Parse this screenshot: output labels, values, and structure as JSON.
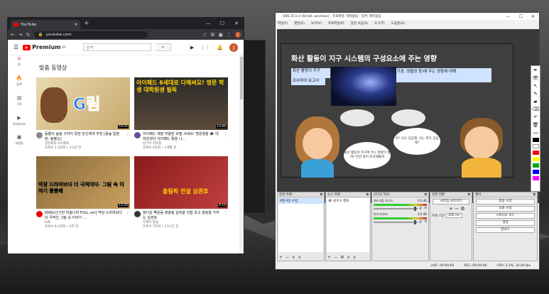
{
  "chrome": {
    "tab_title": "YouTube",
    "new_tab": "+",
    "minimize": "—",
    "maximize": "☐",
    "close": "✕",
    "url": "youtube.com",
    "profile_initial": "J"
  },
  "youtube": {
    "logo": "Premium",
    "logo_region": "KR",
    "search_placeholder": "검색",
    "avatar_initial": "J",
    "nav": [
      {
        "label": "홈",
        "icon": "⌂"
      },
      {
        "label": "탐색",
        "icon": "🔥"
      },
      {
        "label": "구독",
        "icon": "▤"
      },
      {
        "label": "Originals",
        "icon": "▶"
      },
      {
        "label": "보관함",
        "icon": "▣"
      }
    ],
    "section_title": "맞춤 동영상",
    "videos": [
      {
        "title": "동물의 숲을 구하지 못한 당신에게 추천 [동숲 일본판: 팀블드]",
        "channel": "김성회의 G식백과",
        "stats": "조회수 1.3만회 • 1시간 전",
        "duration": "10:25",
        "thumb_text": "G림"
      },
      {
        "title": "아이패드 계발 저렴한 모델 사세요! 명문영을 🎓 대학원생의 아이패드 활용 나...",
        "channel": "방구석 리뷰룸",
        "stats": "조회수 4만회 • 1개월 전",
        "duration": "13:06",
        "thumb_text": "아이패드 6세대로 다해써요! 명문 학생 대학원생 필독"
      },
      {
        "title": "[ENG/신기한 미술나라 FULL ver] 딱당 드라마보다 더 극적인 그림 속 이야기 ...",
        "channel": "tvN",
        "stats": "조회수 8.2만회 • 3주 전",
        "duration": "13:20",
        "thumb_text": "막장 드라마보다 더 극적이다! 그림 속 이야기 통통해"
      },
      {
        "title": "정다운 빡운동 레슬링 실력을 직접 보고 알팅을 가하는 심권호",
        "channel": "우재석 등용",
        "stats": "조회수 7만회 • 17시간 전",
        "duration": "9:16",
        "thumb_text": "올림픽 전설 심권호"
      }
    ]
  },
  "obs": {
    "title": "OBS 25.0.4 (64-bit, windows) - 프로파일: 제목없음 - 장면: 제목없음",
    "menu": [
      "파일(F)",
      "편집(E)",
      "보기(V)",
      "프로파일(P)",
      "장면 모음(S)",
      "도구(T)",
      "도움말(H)"
    ],
    "slide": {
      "title": "화산 활동이 지구 시스템의 구성요소에 주는 영향",
      "line1": "화산 활동이 지구",
      "line1b": "조사하여 보고서",
      "line2": "권, 기권, 생물권 등)에 주는 영향에 대해",
      "bubble_left": "",
      "bubble_right": "",
      "bubble_girl": "화산 활동이 지구에 주는 영향이 뭘까? 한번 같이 조사해볼까",
      "bubble_boy": "어? 나도 궁금해. 너는 뭐가 궁금해?"
    },
    "panels": {
      "scenes": {
        "title": "장면 목록",
        "items": [
          "6월 9일 수업"
        ]
      },
      "sources": {
        "title": "소스 목록",
        "items": [
          "윈도우 캡처"
        ]
      },
      "mixer": {
        "title": "오디오 믹서",
        "tracks": [
          {
            "name": "데스크탑 오디오",
            "db": "0.0 dB"
          },
          {
            "name": "마이크/보조",
            "db": "0.0 dB"
          }
        ]
      },
      "transitions": {
        "title": "장면 전환",
        "type": "사라짐 사라지기",
        "duration_label": "지속 기간",
        "duration": "300 ms"
      },
      "controls": {
        "title": "제어",
        "buttons": [
          "방송 시작",
          "녹화 시작",
          "스튜디오 모드",
          "설정",
          "끝내기"
        ]
      }
    },
    "status": {
      "live": "LIVE: 00:00:00",
      "rec": "REC: 00:00:00",
      "cpu": "CPU: 2.2%, 30.00 fps"
    }
  },
  "pen_toolbar": {
    "colors": [
      "#000000",
      "#ffffff",
      "#ff0000",
      "#ffff00",
      "#00aa00",
      "#0000ff",
      "#ff00ff"
    ]
  }
}
